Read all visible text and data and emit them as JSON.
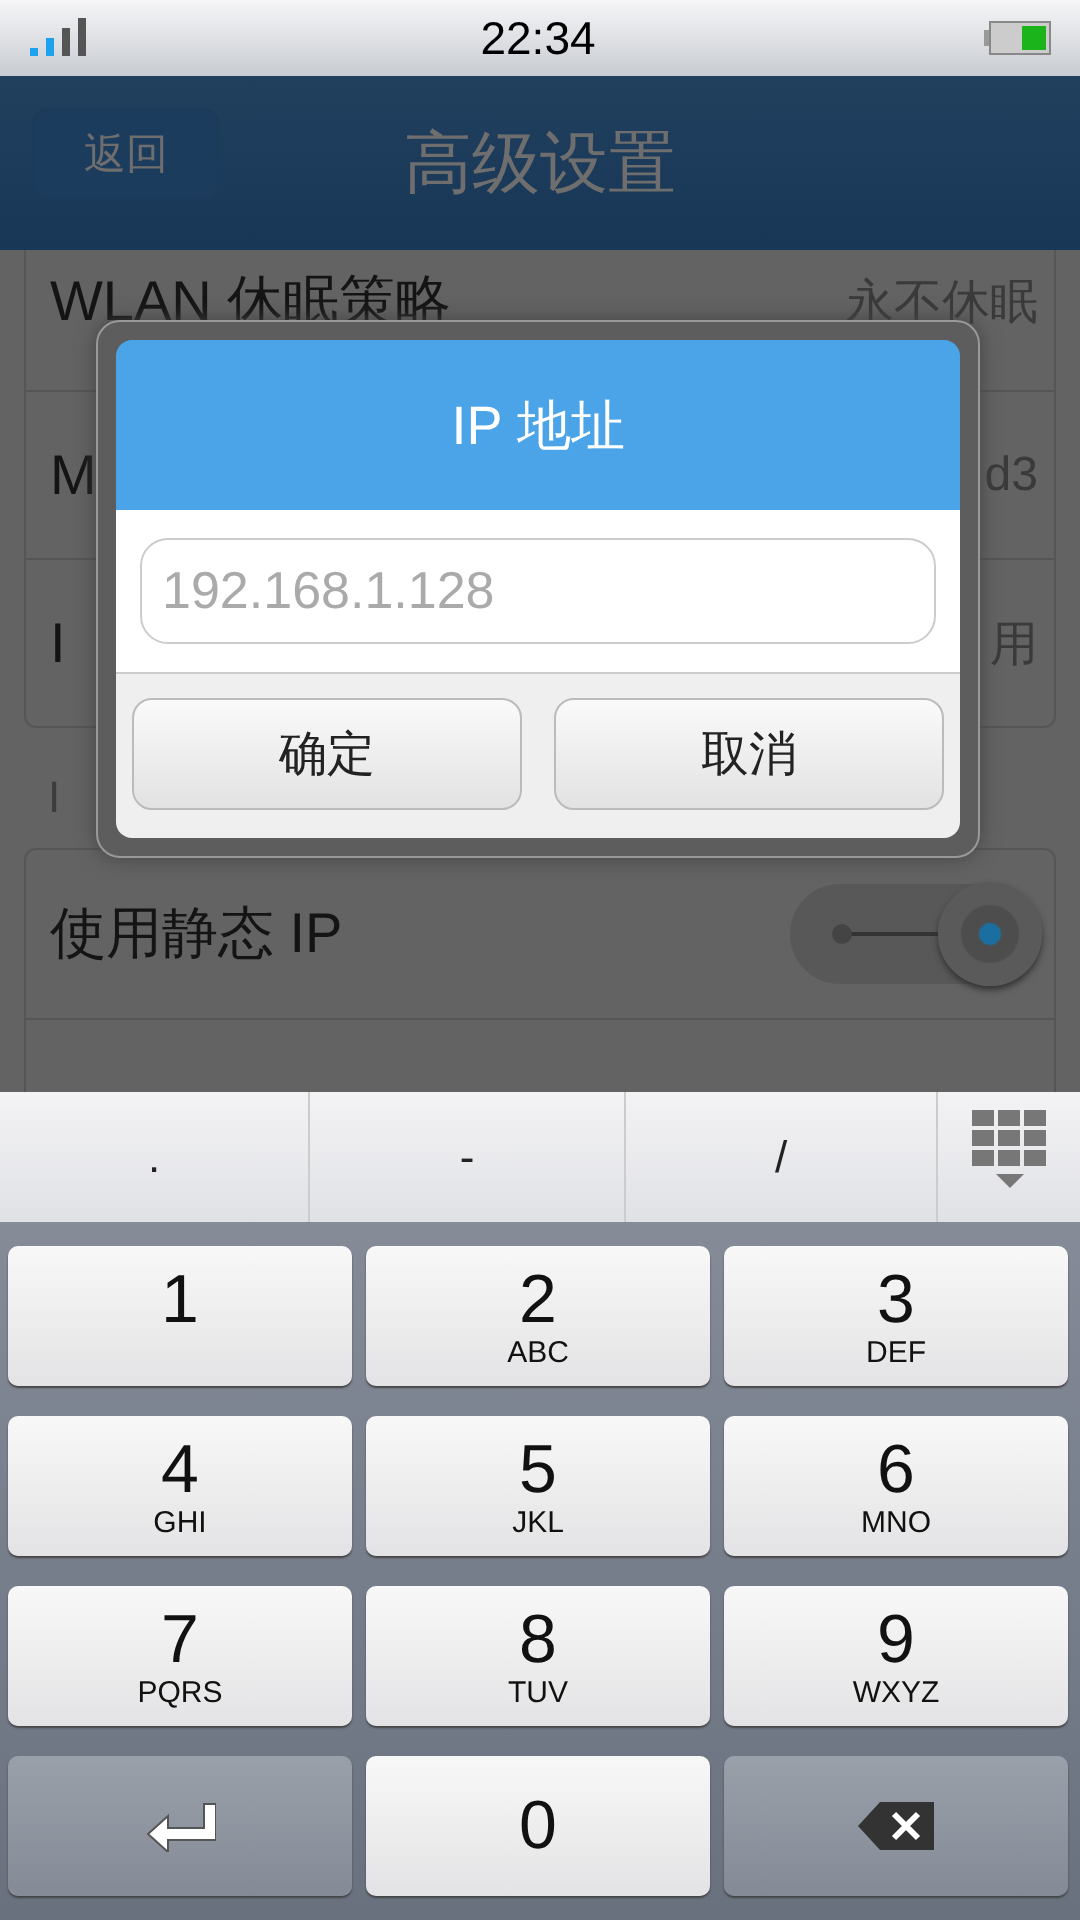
{
  "status_bar": {
    "time": "22:34"
  },
  "header": {
    "back": "返回",
    "title": "高级设置"
  },
  "rows": [
    {
      "kind": "value",
      "label": "WLAN 休眠策略",
      "value": "永不休眠"
    },
    {
      "kind": "value",
      "label": "M",
      "value": "d3"
    },
    {
      "kind": "value",
      "label": "I",
      "value": "用"
    }
  ],
  "section_label": "I",
  "static_rows": [
    {
      "kind": "toggle",
      "label": "使用静态 IP",
      "on": true
    },
    {
      "kind": "blank"
    }
  ],
  "dialog": {
    "title": "IP 地址",
    "placeholder": "192.168.1.128",
    "buttons": [
      "确定",
      "取消"
    ]
  },
  "keyboard": {
    "symbols": [
      ".",
      "-",
      "/"
    ],
    "keys": [
      {
        "digit": "1"
      },
      {
        "digit": "2",
        "letters": "ABC"
      },
      {
        "digit": "3",
        "letters": "DEF"
      },
      {
        "digit": "4",
        "letters": "GHI"
      },
      {
        "digit": "5",
        "letters": "JKL"
      },
      {
        "digit": "6",
        "letters": "MNO"
      },
      {
        "digit": "7",
        "letters": "PQRS"
      },
      {
        "digit": "8",
        "letters": "TUV"
      },
      {
        "digit": "9",
        "letters": "WXYZ"
      }
    ],
    "zero": "0"
  }
}
